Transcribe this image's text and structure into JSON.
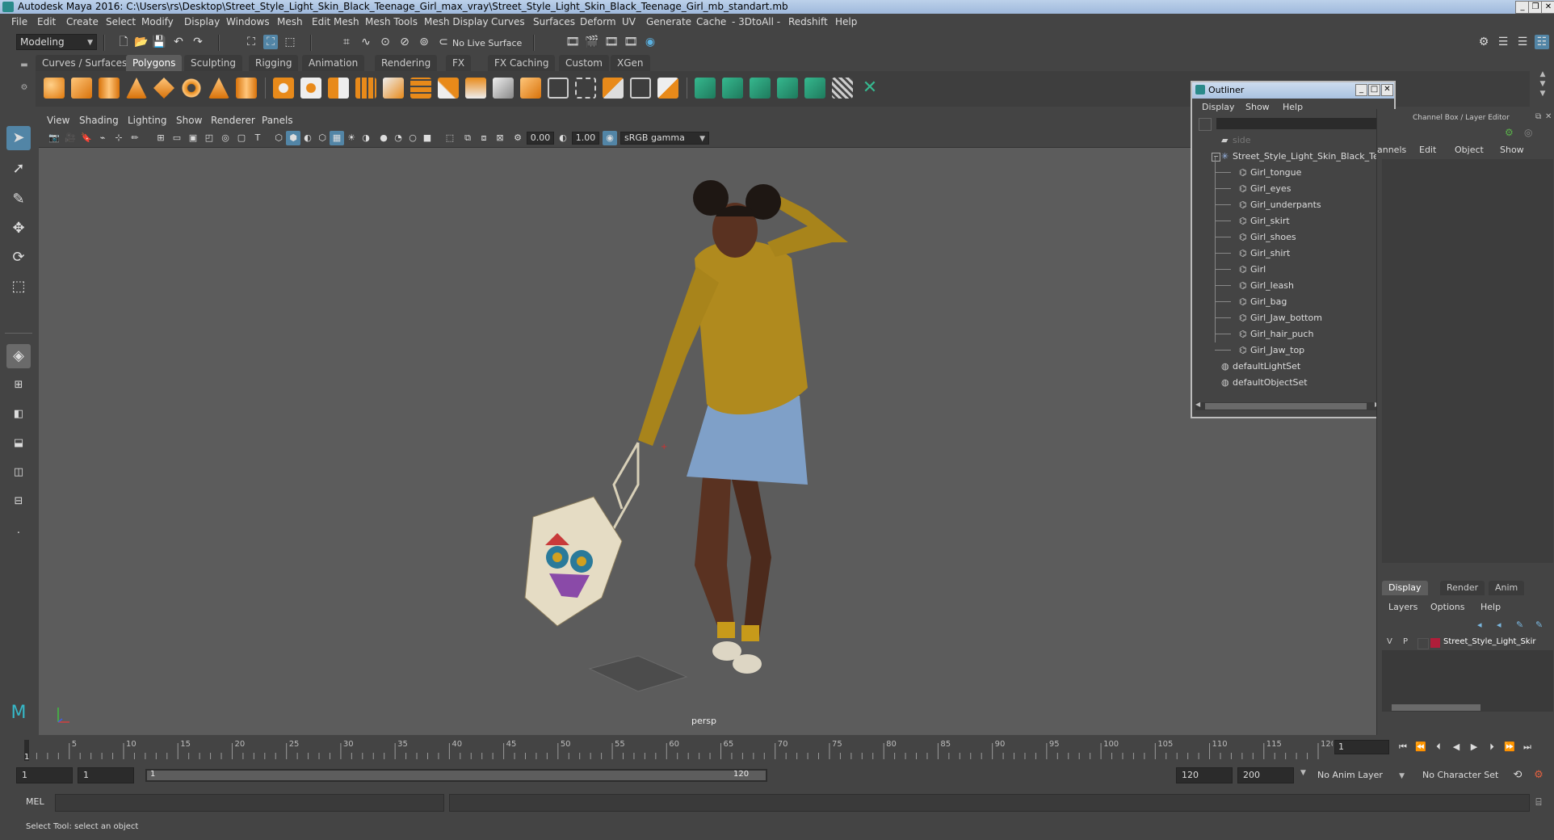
{
  "title": "Autodesk Maya 2016: C:\\Users\\rs\\Desktop\\Street_Style_Light_Skin_Black_Teenage_Girl_max_vray\\Street_Style_Light_Skin_Black_Teenage_Girl_mb_standart.mb",
  "menubar": [
    "File",
    "Edit",
    "Create",
    "Select",
    "Modify",
    "Display",
    "Windows",
    "Mesh",
    "Edit Mesh",
    "Mesh Tools",
    "Mesh Display",
    "Curves",
    "Surfaces",
    "Deform",
    "UV",
    "Generate",
    "Cache",
    "- 3DtoAll -",
    "Redshift",
    "Help"
  ],
  "statusline": {
    "mode": "Modeling",
    "live_surface": "No Live Surface"
  },
  "shelf": {
    "tabs": [
      "Curves / Surfaces",
      "Polygons",
      "Sculpting",
      "Rigging",
      "Animation",
      "Rendering",
      "FX",
      "FX Caching",
      "Custom",
      "XGen"
    ],
    "active_tab": "Polygons"
  },
  "viewport": {
    "menu": [
      "View",
      "Shading",
      "Lighting",
      "Show",
      "Renderer",
      "Panels"
    ],
    "exposure": "0.00",
    "gamma": "1.00",
    "color_space": "sRGB gamma",
    "camera_label": "persp"
  },
  "outliner": {
    "title": "Outliner",
    "menu": [
      "Display",
      "Show",
      "Help"
    ],
    "items": [
      {
        "label": "side",
        "indent": 0,
        "kind": "camera"
      },
      {
        "label": "Street_Style_Light_Skin_Black_Tee",
        "indent": 0,
        "kind": "group"
      },
      {
        "label": "Girl_tongue",
        "indent": 1,
        "kind": "mesh"
      },
      {
        "label": "Girl_eyes",
        "indent": 1,
        "kind": "mesh"
      },
      {
        "label": "Girl_underpants",
        "indent": 1,
        "kind": "mesh"
      },
      {
        "label": "Girl_skirt",
        "indent": 1,
        "kind": "mesh"
      },
      {
        "label": "Girl_shoes",
        "indent": 1,
        "kind": "mesh"
      },
      {
        "label": "Girl_shirt",
        "indent": 1,
        "kind": "mesh"
      },
      {
        "label": "Girl",
        "indent": 1,
        "kind": "mesh"
      },
      {
        "label": "Girl_leash",
        "indent": 1,
        "kind": "mesh"
      },
      {
        "label": "Girl_bag",
        "indent": 1,
        "kind": "mesh"
      },
      {
        "label": "Girl_Jaw_bottom",
        "indent": 1,
        "kind": "mesh"
      },
      {
        "label": "Girl_hair_puch",
        "indent": 1,
        "kind": "mesh"
      },
      {
        "label": "Girl_Jaw_top",
        "indent": 1,
        "kind": "mesh"
      },
      {
        "label": "defaultLightSet",
        "indent": 0,
        "kind": "set"
      },
      {
        "label": "defaultObjectSet",
        "indent": 0,
        "kind": "set"
      }
    ]
  },
  "channelbox": {
    "title": "Channel Box / Layer Editor",
    "menu": [
      "annels",
      "Edit",
      "Object",
      "Show"
    ]
  },
  "layers": {
    "tabs": [
      "Display",
      "Render",
      "Anim"
    ],
    "active_tab": "Display",
    "menu": [
      "Layers",
      "Options",
      "Help"
    ],
    "row": {
      "v": "V",
      "p": "P",
      "name": "Street_Style_Light_Skir",
      "color": "#b01e3a"
    }
  },
  "timeline": {
    "ticks": [
      "5",
      "10",
      "15",
      "20",
      "25",
      "30",
      "35",
      "40",
      "45",
      "50",
      "55",
      "60",
      "65",
      "70",
      "75",
      "80",
      "85",
      "90",
      "95",
      "100",
      "105",
      "110",
      "115",
      "120"
    ],
    "current_label": "1",
    "current_frame": "1"
  },
  "range": {
    "start": "1",
    "start2": "1",
    "slider_start": "1",
    "slider_end": "120",
    "end": "120",
    "end2": "200",
    "anim_layer": "No Anim Layer",
    "character_set": "No Character Set"
  },
  "cmdline": {
    "label": "MEL"
  },
  "helpline": {
    "text": "Select Tool: select an object"
  },
  "colors": {
    "accent": "#5285a6",
    "title_bar": "#a9c2e1",
    "viewport_bg": "#5c5c5c",
    "panel_bg": "#444444"
  }
}
